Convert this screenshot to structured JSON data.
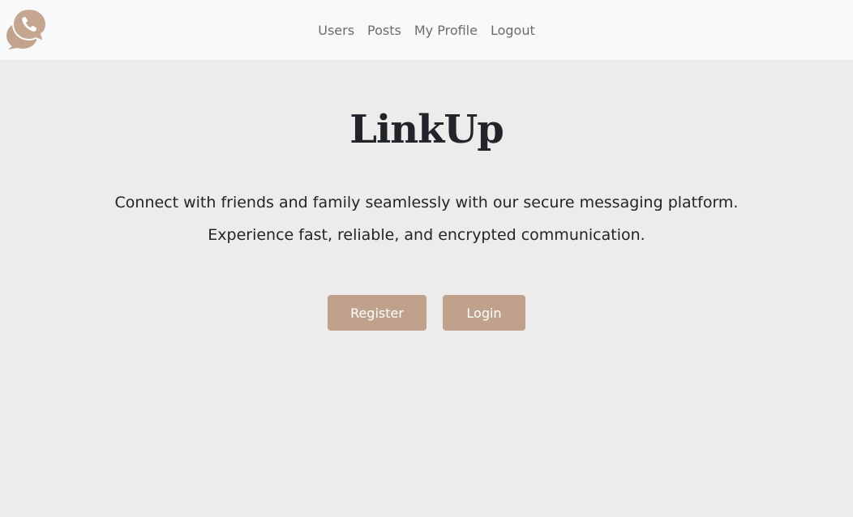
{
  "nav": {
    "logo_icon": "chat-phone-logo-icon",
    "links": [
      {
        "label": "Users"
      },
      {
        "label": "Posts"
      },
      {
        "label": "My Profile"
      },
      {
        "label": "Logout"
      }
    ]
  },
  "hero": {
    "title": "LinkUp",
    "tagline_line1": "Connect with friends and family seamlessly with our secure messaging platform.",
    "tagline_line2": "Experience fast, reliable, and encrypted communication."
  },
  "actions": {
    "register_label": "Register",
    "login_label": "Login"
  },
  "colors": {
    "navbar_bg": "#f8f9fb",
    "page_bg": "#eeecea",
    "accent": "#bfa18c",
    "text": "#212529",
    "nav_text": "#6c6c6c"
  }
}
